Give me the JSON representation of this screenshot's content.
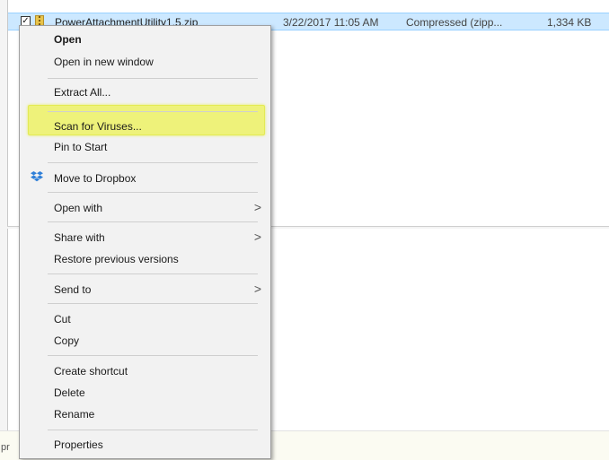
{
  "file_row": {
    "name": "PowerAttachmentUtility1.5.zip",
    "date_modified": "3/22/2017 11:05 AM",
    "type": "Compressed (zipp...",
    "size": "1,334 KB"
  },
  "status_bar": {
    "text": "pr"
  },
  "context_menu": {
    "open": "Open",
    "open_new_window": "Open in new window",
    "extract_all": "Extract All...",
    "scan_viruses": "Scan for Viruses...",
    "pin_to_start": "Pin to Start",
    "move_to_dropbox": "Move to Dropbox",
    "open_with": "Open with",
    "share_with": "Share with",
    "restore_versions": "Restore previous versions",
    "send_to": "Send to",
    "cut": "Cut",
    "copy": "Copy",
    "create_shortcut": "Create shortcut",
    "delete": "Delete",
    "rename": "Rename",
    "properties": "Properties",
    "submenu_glyph": ">"
  },
  "colors": {
    "selection": "#cce8ff",
    "highlight": "#eef27a",
    "menu_background": "#f2f2f2",
    "dropbox_blue": "#2f7fd8"
  },
  "icons": [
    "checkbox-icon",
    "zip-folder-icon",
    "dropbox-icon",
    "chevron-right-icon"
  ]
}
